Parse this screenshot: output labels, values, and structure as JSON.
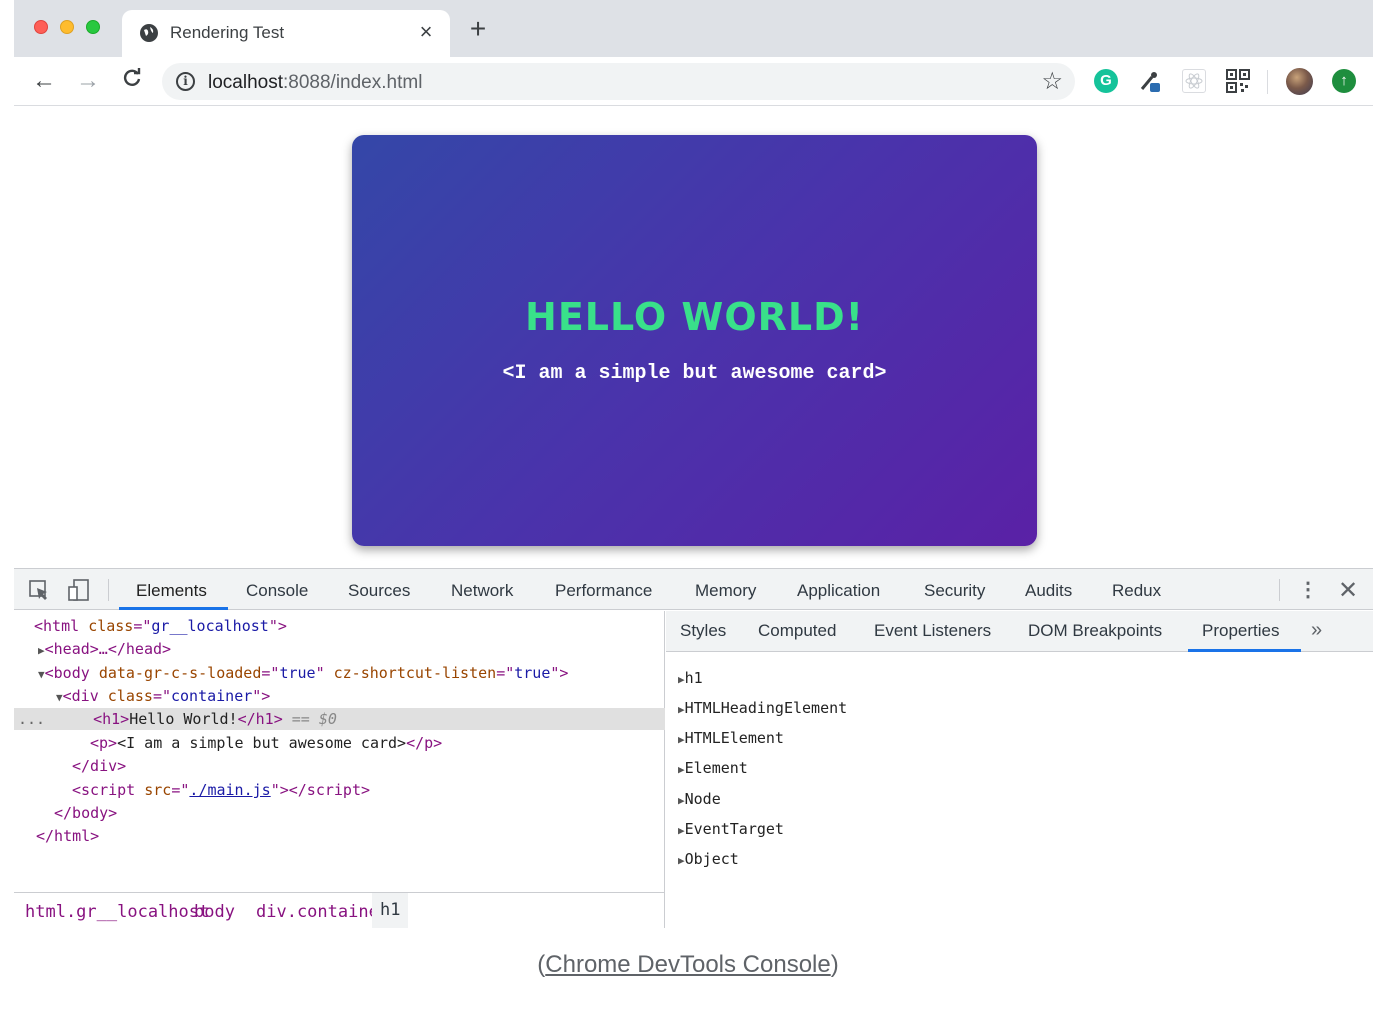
{
  "browser": {
    "tab": {
      "title": "Rendering Test",
      "close": "×"
    },
    "new_tab": "+",
    "nav": {
      "back": "←",
      "forward": "→",
      "reload": "C"
    },
    "url": {
      "host": "localhost",
      "rest": ":8088/index.html"
    },
    "info_icon": "i",
    "star": "☆",
    "extensions": {
      "grammarly": "G",
      "update": "↑"
    }
  },
  "page": {
    "card": {
      "title": "HELLO WORLD!",
      "subtitle": "<I am a simple but awesome card>"
    }
  },
  "devtools": {
    "tabs": [
      "Elements",
      "Console",
      "Sources",
      "Network",
      "Performance",
      "Memory",
      "Application",
      "Security",
      "Audits",
      "Redux"
    ],
    "active_tab": "Elements",
    "menu": "⋮",
    "close": "✕",
    "dom": {
      "html_open": {
        "tag": "html",
        "attr": "class",
        "val": "gr__localhost"
      },
      "head": "<head>…</head>",
      "body_open": {
        "attr1": "data-gr-c-s-loaded",
        "val1": "true",
        "attr2": "cz-shortcut-listen",
        "val2": "true"
      },
      "div_open": {
        "attr": "class",
        "val": "container"
      },
      "h1_text": "Hello World!",
      "selected_marker": "== $0",
      "p_text": "<I am a simple but awesome card>",
      "script_src": "./main.js",
      "ellipsis": "..."
    },
    "breadcrumbs": [
      "html.gr__localhost",
      "body",
      "div.container",
      "h1"
    ],
    "side_tabs": [
      "Styles",
      "Computed",
      "Event Listeners",
      "DOM Breakpoints",
      "Properties"
    ],
    "side_active": "Properties",
    "side_more": "»",
    "properties": [
      "h1",
      "HTMLHeadingElement",
      "HTMLElement",
      "Element",
      "Node",
      "EventTarget",
      "Object"
    ]
  },
  "caption": {
    "open": "(",
    "link": "Chrome DevTools Console",
    "close": ")"
  },
  "colors": {
    "card_gradient_start": "#3447a8",
    "card_gradient_end": "#5a21a6",
    "card_title": "#39e08a",
    "active_underline": "#1a73e8"
  }
}
